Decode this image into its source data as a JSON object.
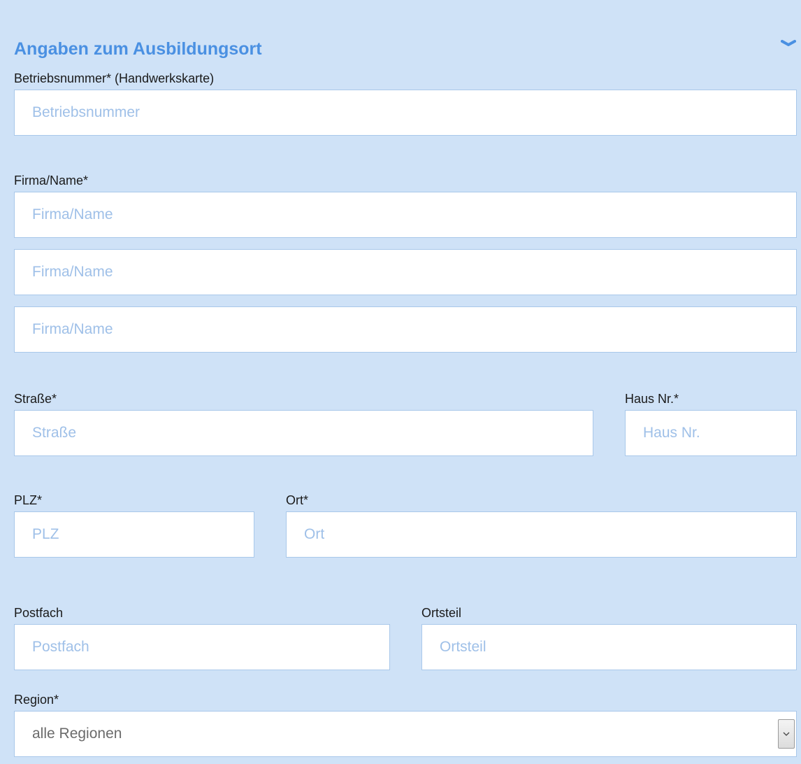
{
  "section": {
    "title": "Angaben zum Ausbildungsort"
  },
  "betriebsnummer": {
    "label": "Betriebsnummer* (Handwerkskarte)",
    "placeholder": "Betriebsnummer"
  },
  "firma": {
    "label": "Firma/Name*",
    "placeholders": [
      "Firma/Name",
      "Firma/Name",
      "Firma/Name"
    ]
  },
  "strasse": {
    "label": "Straße*",
    "placeholder": "Straße"
  },
  "hausnr": {
    "label": "Haus Nr.*",
    "placeholder": "Haus Nr."
  },
  "plz": {
    "label": "PLZ*",
    "placeholder": "PLZ"
  },
  "ort": {
    "label": "Ort*",
    "placeholder": "Ort"
  },
  "postfach": {
    "label": "Postfach",
    "placeholder": "Postfach"
  },
  "ortsteil": {
    "label": "Ortsteil",
    "placeholder": "Ortsteil"
  },
  "region": {
    "label": "Region*",
    "selected": "alle Regionen"
  },
  "colors": {
    "background": "#cfe2f7",
    "accent": "#4a90e2",
    "placeholder": "#9fc0e8",
    "border": "#a9c8ea"
  },
  "icons": {
    "collapse": "chevron-down-icon",
    "select": "chevron-down-icon"
  }
}
